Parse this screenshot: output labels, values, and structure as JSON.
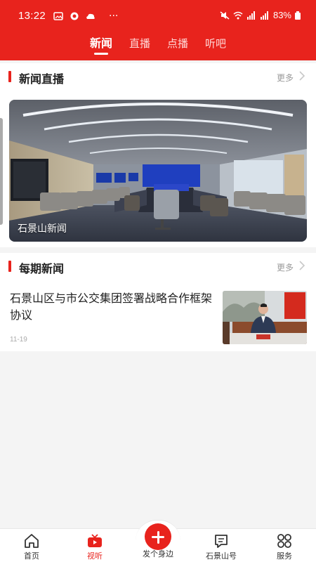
{
  "status": {
    "time": "13:22",
    "more": "···",
    "battery": "83%"
  },
  "tabs": [
    {
      "label": "新闻",
      "active": true
    },
    {
      "label": "直播",
      "active": false
    },
    {
      "label": "点播",
      "active": false
    },
    {
      "label": "听吧",
      "active": false
    }
  ],
  "live_section": {
    "title": "新闻直播",
    "more": "更多",
    "item_caption": "石景山新闻"
  },
  "periodic_section": {
    "title": "每期新闻",
    "more": "更多",
    "item": {
      "title": "石景山区与市公交集团签署战略合作框架协议",
      "date": "11-19"
    }
  },
  "bottom_nav": [
    {
      "label": "首页",
      "icon": "home-icon",
      "active": false
    },
    {
      "label": "视听",
      "icon": "tv-icon",
      "active": true
    },
    {
      "label": "发个身边",
      "icon": "plus-icon",
      "active": false
    },
    {
      "label": "石景山号",
      "icon": "message-icon",
      "active": false
    },
    {
      "label": "服务",
      "icon": "grid-icon",
      "active": false
    }
  ],
  "colors": {
    "brand_red": "#e8231d",
    "muted": "#9a9a9a"
  }
}
